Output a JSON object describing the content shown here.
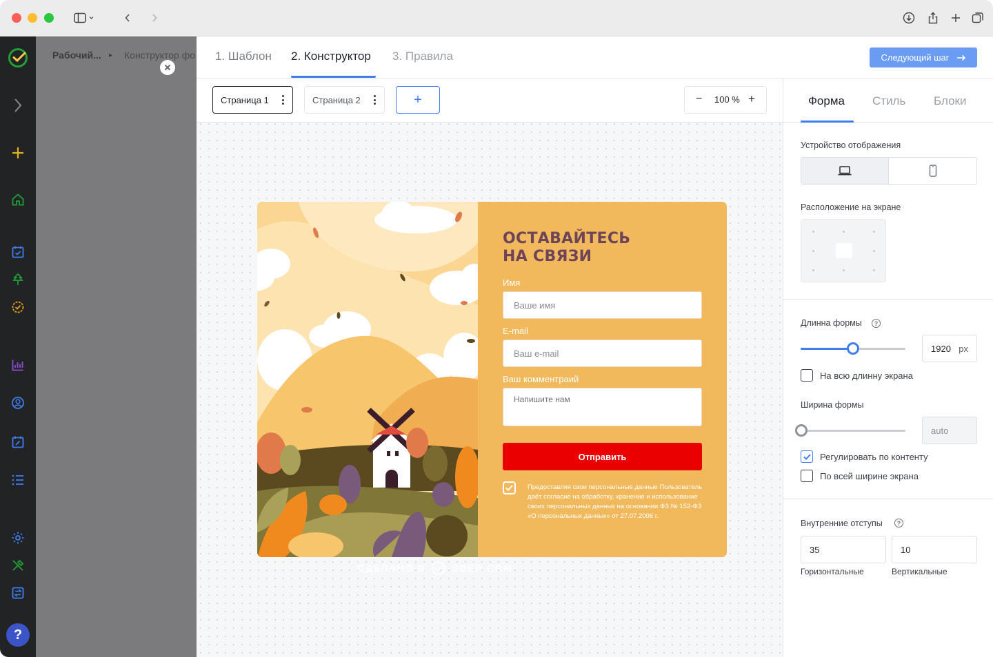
{
  "breadcrumb": {
    "item1": "Рабочий...",
    "item2": "Конструктор фо"
  },
  "steps": [
    {
      "label": "1. Шаблон"
    },
    {
      "label": "2. Конструктор"
    },
    {
      "label": "3. Правила"
    }
  ],
  "next_button": {
    "label": "Следующий шаг"
  },
  "pages": {
    "page1": "Страница 1",
    "page2": "Страница 2",
    "add": "+"
  },
  "zoom": {
    "minus": "−",
    "value": "100 %",
    "plus": "+"
  },
  "form": {
    "title_line1": "ОСТАВАЙТЕСЬ",
    "title_line2": "НА СВЯЗИ",
    "name_label": "Имя",
    "name_placeholder": "Ваше имя",
    "email_label": "E-mail",
    "email_placeholder": "Ваш e-mail",
    "comment_label": "Ваш комментраий",
    "comment_placeholder": "Напишите нам",
    "submit": "Отправить",
    "consent": "Предоставляя свои персональные данные Пользователь даёт согласие на обработку, хранение и использование своих персональных данных на основании ФЗ № 152-ФЗ «О персональных данных» от 27.07.2006 г.",
    "consent_checked": true,
    "watermark_prefix": "СДЕЛАНО В",
    "watermark_brand": "SBER CRM"
  },
  "panel": {
    "tabs": [
      {
        "label": "Форма"
      },
      {
        "label": "Стиль"
      },
      {
        "label": "Блоки"
      }
    ],
    "device_label": "Устройство отображения",
    "position_label": "Расположение на экране",
    "length_label": "Длинна формы",
    "length_value": "1920",
    "length_unit": "px",
    "length_slider": 0.5,
    "full_length_label": "На всю длинну экрана",
    "full_length_checked": false,
    "width_label": "Ширина формы",
    "width_value": "auto",
    "width_slider": 0,
    "fit_content_label": "Регулировать по контенту",
    "fit_content_checked": true,
    "full_width_label": "По всей ширине экрана",
    "full_width_checked": false,
    "padding_label": "Внутренние отступы",
    "padding_h": "35",
    "padding_v": "10",
    "padding_h_label": "Горизонтальные",
    "padding_v_label": "Вертикальные"
  },
  "colors": {
    "accent": "#3f7df0",
    "form_bg": "#f2b95c",
    "submit": "#ea0000",
    "title": "#6e4458"
  }
}
